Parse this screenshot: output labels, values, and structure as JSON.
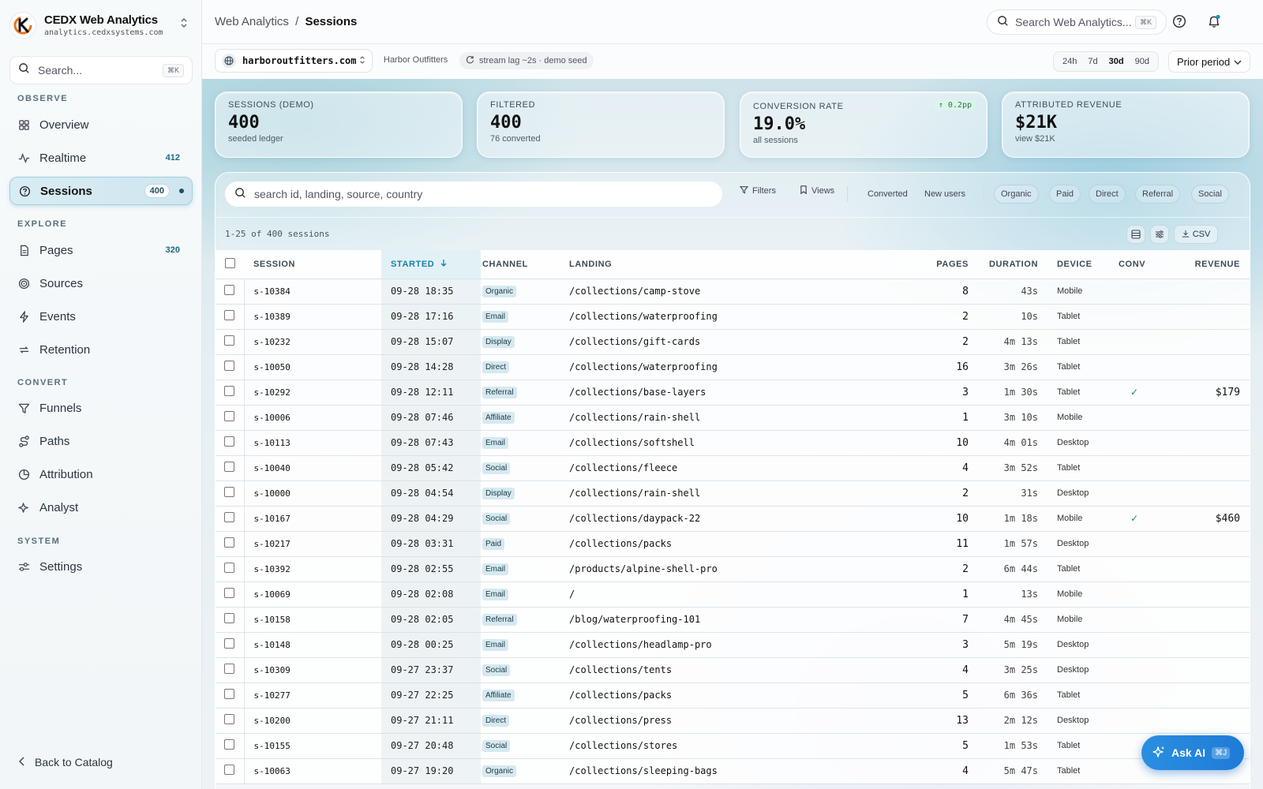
{
  "brand": {
    "name": "CEDX Web Analytics",
    "domain": "analytics.cedxsystems.com"
  },
  "sidebar": {
    "search_placeholder": "Search...",
    "search_kbd": "⌘K",
    "sections": {
      "observe": "OBSERVE",
      "explore": "EXPLORE",
      "convert": "CONVERT",
      "system": "SYSTEM"
    },
    "items": {
      "overview": {
        "label": "Overview"
      },
      "realtime": {
        "label": "Realtime",
        "count": "412"
      },
      "sessions": {
        "label": "Sessions",
        "count": "400"
      },
      "pages": {
        "label": "Pages",
        "count": "320"
      },
      "sources": {
        "label": "Sources"
      },
      "events": {
        "label": "Events"
      },
      "retention": {
        "label": "Retention"
      },
      "funnels": {
        "label": "Funnels"
      },
      "paths": {
        "label": "Paths"
      },
      "attribution": {
        "label": "Attribution"
      },
      "analyst": {
        "label": "Analyst"
      },
      "settings": {
        "label": "Settings"
      }
    },
    "back_label": "Back to Catalog"
  },
  "topbar": {
    "crumb_root": "Web Analytics",
    "crumb_sep": "/",
    "crumb_current": "Sessions",
    "search_placeholder": "Search Web Analytics...",
    "search_kbd": "⌘K"
  },
  "subbar": {
    "site": "harboroutfitters.com",
    "org": "Harbor Outfitters",
    "lag": "stream lag ~2s · demo seed",
    "ranges": [
      "24h",
      "7d",
      "30d",
      "90d"
    ],
    "active_range": "30d",
    "period": "Prior period"
  },
  "kpis": [
    {
      "label": "SESSIONS (DEMO)",
      "value": "400",
      "sub": "seeded ledger"
    },
    {
      "label": "FILTERED",
      "value": "400",
      "sub": "76 converted"
    },
    {
      "label": "CONVERSION RATE",
      "value": "19.0%",
      "sub": "all sessions",
      "delta": "↑ 0.2pp"
    },
    {
      "label": "ATTRIBUTED REVENUE",
      "value": "$21K",
      "sub": "view $21K"
    }
  ],
  "filters": {
    "search_placeholder": "search id, landing, source, country",
    "filters_label": "Filters",
    "views_label": "Views",
    "converted_label": "Converted",
    "new_users_label": "New users",
    "channels": [
      "Organic",
      "Paid",
      "Direct",
      "Referral",
      "Social"
    ]
  },
  "table": {
    "count_label": "1-25 of 400 sessions",
    "csv_label": "CSV",
    "columns": {
      "session": "SESSION",
      "started": "STARTED",
      "channel": "CHANNEL",
      "landing": "LANDING",
      "pages": "PAGES",
      "duration": "DURATION",
      "device": "DEVICE",
      "conv": "CONV",
      "revenue": "REVENUE"
    },
    "rows": [
      {
        "id": "s-10384",
        "started": "09-28 18:35",
        "channel": "Organic",
        "landing": "/collections/camp-stove",
        "pages": "8",
        "duration": "43s",
        "device": "Mobile",
        "conv": "",
        "revenue": ""
      },
      {
        "id": "s-10389",
        "started": "09-28 17:16",
        "channel": "Email",
        "landing": "/collections/waterproofing",
        "pages": "2",
        "duration": "10s",
        "device": "Tablet",
        "conv": "",
        "revenue": ""
      },
      {
        "id": "s-10232",
        "started": "09-28 15:07",
        "channel": "Display",
        "landing": "/collections/gift-cards",
        "pages": "2",
        "duration": "4m 13s",
        "device": "Tablet",
        "conv": "",
        "revenue": ""
      },
      {
        "id": "s-10050",
        "started": "09-28 14:28",
        "channel": "Direct",
        "landing": "/collections/waterproofing",
        "pages": "16",
        "duration": "3m 26s",
        "device": "Tablet",
        "conv": "",
        "revenue": ""
      },
      {
        "id": "s-10292",
        "started": "09-28 12:11",
        "channel": "Referral",
        "landing": "/collections/base-layers",
        "pages": "3",
        "duration": "1m 30s",
        "device": "Tablet",
        "conv": "✓",
        "revenue": "$179"
      },
      {
        "id": "s-10006",
        "started": "09-28 07:46",
        "channel": "Affiliate",
        "landing": "/collections/rain-shell",
        "pages": "1",
        "duration": "3m 10s",
        "device": "Mobile",
        "conv": "",
        "revenue": ""
      },
      {
        "id": "s-10113",
        "started": "09-28 07:43",
        "channel": "Email",
        "landing": "/collections/softshell",
        "pages": "10",
        "duration": "4m 01s",
        "device": "Desktop",
        "conv": "",
        "revenue": ""
      },
      {
        "id": "s-10040",
        "started": "09-28 05:42",
        "channel": "Social",
        "landing": "/collections/fleece",
        "pages": "4",
        "duration": "3m 52s",
        "device": "Tablet",
        "conv": "",
        "revenue": ""
      },
      {
        "id": "s-10000",
        "started": "09-28 04:54",
        "channel": "Display",
        "landing": "/collections/rain-shell",
        "pages": "2",
        "duration": "31s",
        "device": "Desktop",
        "conv": "",
        "revenue": ""
      },
      {
        "id": "s-10167",
        "started": "09-28 04:29",
        "channel": "Social",
        "landing": "/collections/daypack-22",
        "pages": "10",
        "duration": "1m 18s",
        "device": "Mobile",
        "conv": "✓",
        "revenue": "$460"
      },
      {
        "id": "s-10217",
        "started": "09-28 03:31",
        "channel": "Paid",
        "landing": "/collections/packs",
        "pages": "11",
        "duration": "1m 57s",
        "device": "Desktop",
        "conv": "",
        "revenue": ""
      },
      {
        "id": "s-10392",
        "started": "09-28 02:55",
        "channel": "Email",
        "landing": "/products/alpine-shell-pro",
        "pages": "2",
        "duration": "6m 44s",
        "device": "Tablet",
        "conv": "",
        "revenue": ""
      },
      {
        "id": "s-10069",
        "started": "09-28 02:08",
        "channel": "Email",
        "landing": "/",
        "pages": "1",
        "duration": "13s",
        "device": "Mobile",
        "conv": "",
        "revenue": ""
      },
      {
        "id": "s-10158",
        "started": "09-28 02:05",
        "channel": "Referral",
        "landing": "/blog/waterproofing-101",
        "pages": "7",
        "duration": "4m 45s",
        "device": "Mobile",
        "conv": "",
        "revenue": ""
      },
      {
        "id": "s-10148",
        "started": "09-28 00:25",
        "channel": "Email",
        "landing": "/collections/headlamp-pro",
        "pages": "3",
        "duration": "5m 19s",
        "device": "Desktop",
        "conv": "",
        "revenue": ""
      },
      {
        "id": "s-10309",
        "started": "09-27 23:37",
        "channel": "Social",
        "landing": "/collections/tents",
        "pages": "4",
        "duration": "3m 25s",
        "device": "Desktop",
        "conv": "",
        "revenue": ""
      },
      {
        "id": "s-10277",
        "started": "09-27 22:25",
        "channel": "Affiliate",
        "landing": "/collections/packs",
        "pages": "5",
        "duration": "6m 36s",
        "device": "Tablet",
        "conv": "",
        "revenue": ""
      },
      {
        "id": "s-10200",
        "started": "09-27 21:11",
        "channel": "Direct",
        "landing": "/collections/press",
        "pages": "13",
        "duration": "2m 12s",
        "device": "Desktop",
        "conv": "",
        "revenue": ""
      },
      {
        "id": "s-10155",
        "started": "09-27 20:48",
        "channel": "Social",
        "landing": "/collections/stores",
        "pages": "5",
        "duration": "1m 53s",
        "device": "Tablet",
        "conv": "",
        "revenue": ""
      },
      {
        "id": "s-10063",
        "started": "09-27 19:20",
        "channel": "Organic",
        "landing": "/collections/sleeping-bags",
        "pages": "4",
        "duration": "5m 47s",
        "device": "Tablet",
        "conv": "",
        "revenue": ""
      }
    ]
  },
  "ask_ai": {
    "label": "Ask AI",
    "kbd": "⌘J"
  }
}
